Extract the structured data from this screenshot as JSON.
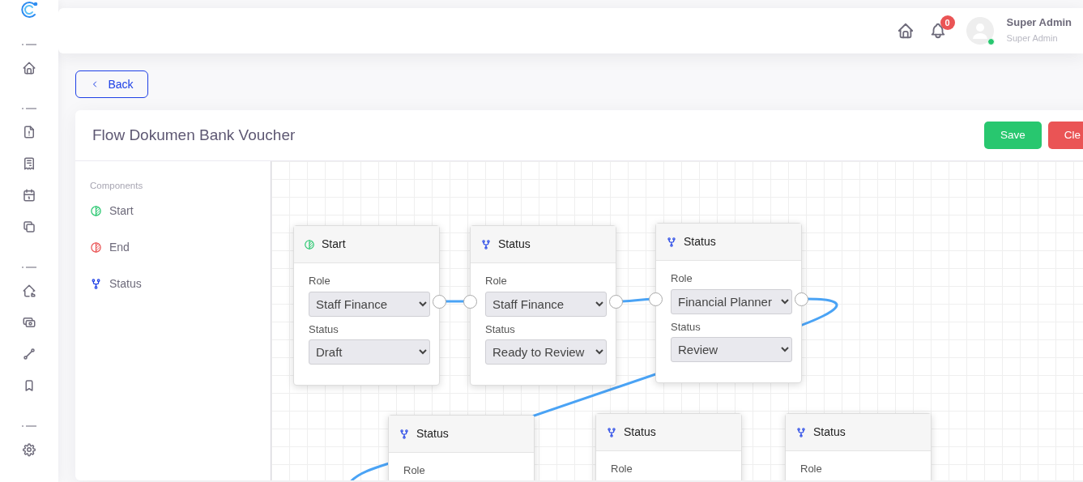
{
  "header": {
    "notification_count": "0",
    "user": {
      "name": "Super Admin",
      "role": "Super Admin",
      "online": true
    }
  },
  "back_button": {
    "label": "Back"
  },
  "card": {
    "title": "Flow Dokumen Bank Voucher",
    "buttons": [
      {
        "label": "Save",
        "kind": "success"
      },
      {
        "label": "Cle",
        "kind": "danger"
      }
    ]
  },
  "components": {
    "heading": "Components",
    "items": [
      {
        "label": "Start",
        "kind": "start"
      },
      {
        "label": "End",
        "kind": "end"
      },
      {
        "label": "Status",
        "kind": "status"
      }
    ]
  },
  "nodes": [
    {
      "kind": "start",
      "title": "Start",
      "fields": [
        {
          "label": "Role",
          "value": "Staff Finance"
        },
        {
          "label": "Status",
          "value": "Draft"
        }
      ]
    },
    {
      "kind": "status",
      "title": "Status",
      "fields": [
        {
          "label": "Role",
          "value": "Staff Finance"
        },
        {
          "label": "Status",
          "value": "Ready to Review"
        }
      ]
    },
    {
      "kind": "status",
      "title": "Status",
      "fields": [
        {
          "label": "Role",
          "value": "Financial Planner"
        },
        {
          "label": "Status",
          "value": "Review"
        }
      ]
    },
    {
      "kind": "status",
      "title": "Status",
      "fields": [
        {
          "label": "Role"
        }
      ]
    },
    {
      "kind": "status",
      "title": "Status",
      "fields": [
        {
          "label": "Role"
        }
      ]
    },
    {
      "kind": "status",
      "title": "Status",
      "fields": [
        {
          "label": "Role"
        }
      ]
    }
  ]
}
